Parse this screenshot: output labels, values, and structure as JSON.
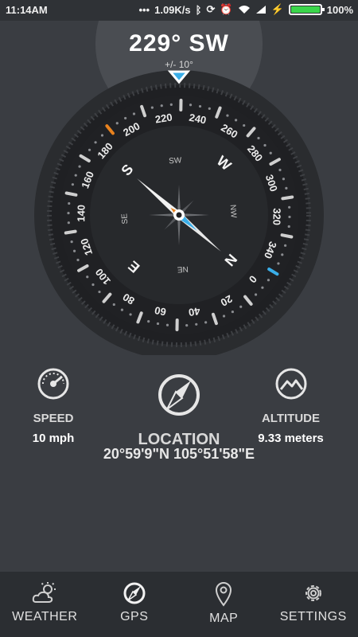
{
  "status_bar": {
    "time": "11:14AM",
    "network_speed": "1.09K/s",
    "battery_percent": "100%",
    "battery_level": 1.0,
    "battery_color": "#3bd64b"
  },
  "compass": {
    "heading": "229° SW",
    "accuracy": "+/- 10°",
    "bearing_deg": 229,
    "degree_labels": [
      "0",
      "20",
      "40",
      "60",
      "80",
      "100",
      "120",
      "140",
      "160",
      "180",
      "200",
      "220",
      "240",
      "260",
      "280",
      "300",
      "320",
      "340"
    ],
    "cardinals": {
      "n": "N",
      "e": "E",
      "s": "S",
      "w": "W"
    },
    "intercardinals": {
      "ne": "NE",
      "se": "SE",
      "sw": "SW",
      "nw": "NW"
    },
    "accent_orange": "#e8821e",
    "accent_blue": "#3aaee8"
  },
  "stats": {
    "speed": {
      "label": "SPEED",
      "value": "10 mph"
    },
    "location": {
      "label": "LOCATION",
      "coords": "20°59'9\"N 105°51'58\"E"
    },
    "altitude": {
      "label": "ALTITUDE",
      "value": "9.33 meters"
    }
  },
  "nav": [
    {
      "label": "WEATHER",
      "icon": "weather-icon"
    },
    {
      "label": "GPS",
      "icon": "compass-icon"
    },
    {
      "label": "MAP",
      "icon": "map-pin-icon"
    },
    {
      "label": "SETTINGS",
      "icon": "gear-icon"
    }
  ]
}
